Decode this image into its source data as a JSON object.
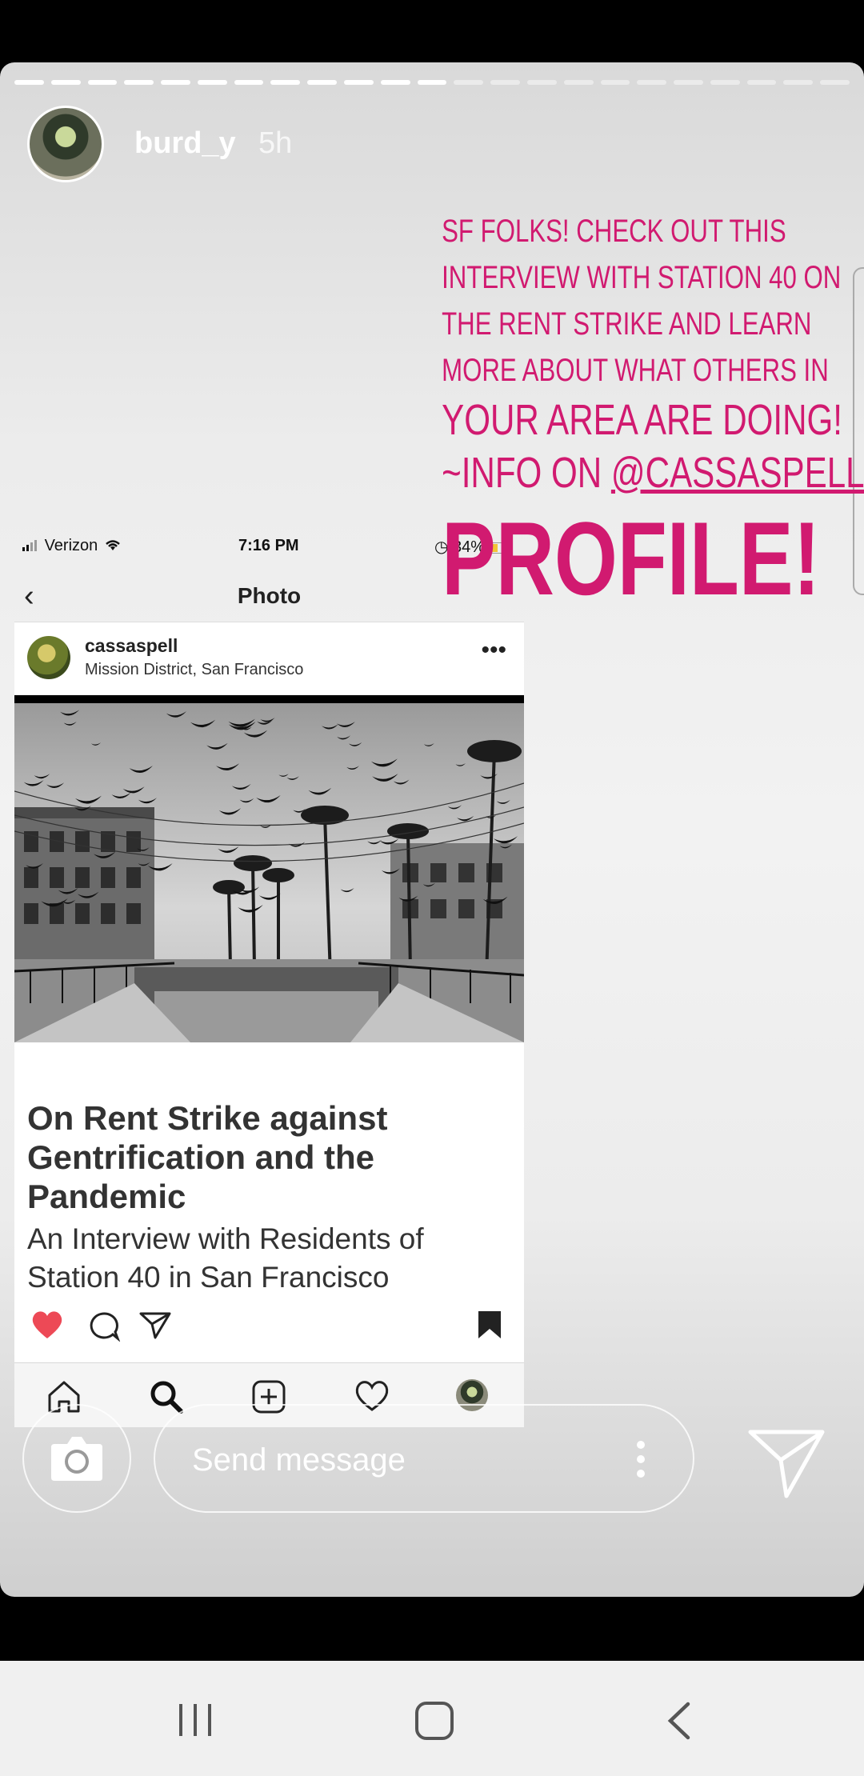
{
  "story": {
    "username": "burd_y",
    "time_ago": "5h",
    "progress": {
      "segments": 23,
      "completed": 12
    },
    "caption": {
      "lines": [
        "SF FOLKS! CHECK OUT THIS",
        "INTERVIEW WITH STATION 40 ON",
        "THE RENT STRIKE AND LEARN",
        "MORE ABOUT WHAT OTHERS IN"
      ],
      "line5": "YOUR AREA ARE DOING!",
      "line6_prefix": "~INFO ON ",
      "line6_handle": "@CASSASPELL",
      "line7": "PROFILE!"
    }
  },
  "embedded": {
    "status_bar": {
      "carrier": "Verizon",
      "time": "7:16 PM",
      "battery": "34%"
    },
    "header_title": "Photo",
    "post": {
      "username": "cassaspell",
      "location": "Mission District, San Francisco",
      "headline": "On Rent Strike against Gentrification and the Pandemic",
      "subheadline": "An Interview with Residents of Station 40 in San Francisco"
    }
  },
  "reply_bar": {
    "placeholder": "Send message"
  },
  "colors": {
    "caption": "#d11a70",
    "like": "#ed4956"
  },
  "icons": [
    "camera-icon",
    "send-icon",
    "more-vertical-icon",
    "heart-icon",
    "comment-icon",
    "share-icon",
    "bookmark-icon",
    "home-icon",
    "search-icon",
    "add-icon",
    "activity-icon",
    "recent-apps-icon",
    "home-button-icon",
    "back-icon"
  ]
}
